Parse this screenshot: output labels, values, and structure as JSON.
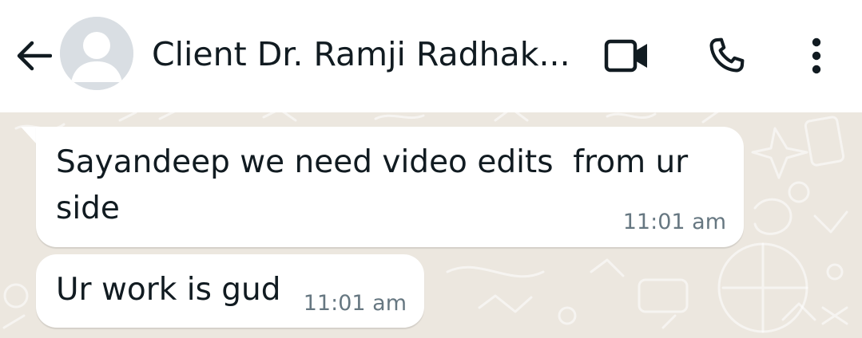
{
  "header": {
    "contact_name": "Client Dr. Ramji Radhak...",
    "back_icon": "arrow-left-icon",
    "avatar_icon": "default-avatar-icon",
    "video_icon": "video-camera-icon",
    "call_icon": "phone-icon",
    "menu_icon": "more-vertical-icon"
  },
  "messages": [
    {
      "direction": "incoming",
      "text": "Sayandeep we need video edits  from ur\nside",
      "time": "11:01 am"
    },
    {
      "direction": "incoming",
      "text": "Ur work is gud",
      "time": "11:01 am"
    }
  ],
  "colors": {
    "header_bg": "#ffffff",
    "chat_bg": "#ece7df",
    "bubble_bg": "#ffffff",
    "text": "#111b21",
    "time": "#667781"
  }
}
